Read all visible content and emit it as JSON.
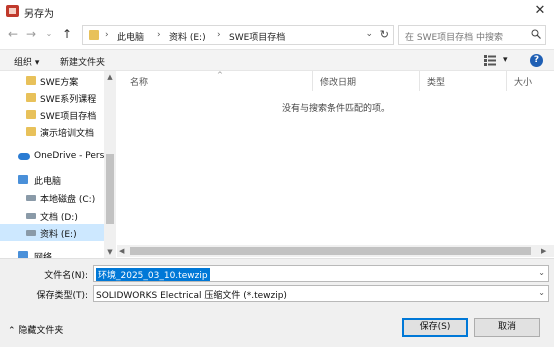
{
  "window": {
    "title": "另存为",
    "close_glyph": "✕"
  },
  "address_bar": {
    "crumbs": [
      "此电脑",
      "资料 (E:)",
      "SWE项目存档"
    ],
    "separator": "›"
  },
  "search": {
    "placeholder": "在 SWE项目存档 中搜索"
  },
  "toolbar": {
    "organize": "组织 ▾",
    "new_folder": "新建文件夹",
    "view_caret": "▾",
    "help": "?"
  },
  "nav_pane": {
    "items": [
      {
        "label": "SWE方案",
        "icon": "folder-icon"
      },
      {
        "label": "SWE系列课程",
        "icon": "folder-icon"
      },
      {
        "label": "SWE项目存档",
        "icon": "folder-icon"
      },
      {
        "label": "演示培训文档",
        "icon": "folder-icon"
      },
      {
        "label": "OneDrive - Perso",
        "icon": "cloud-icon"
      },
      {
        "label": "此电脑",
        "icon": "computer-icon"
      },
      {
        "label": "本地磁盘 (C:)",
        "icon": "drive-icon"
      },
      {
        "label": "文档 (D:)",
        "icon": "drive-icon"
      },
      {
        "label": "资料 (E:)",
        "icon": "drive-icon",
        "selected": true
      },
      {
        "label": "网络",
        "icon": "network-icon"
      }
    ]
  },
  "file_list": {
    "columns": [
      "名称",
      "修改日期",
      "类型",
      "大小"
    ],
    "empty_message": "没有与搜索条件匹配的项。"
  },
  "form": {
    "filename_label": "文件名(N):",
    "filename_value": "环境_2025_03_10.tewzip",
    "filetype_label": "保存类型(T):",
    "filetype_value": "SOLIDWORKS Electrical 压缩文件 (*.tewzip)"
  },
  "footer": {
    "hide_folders": "隐藏文件夹",
    "save": "保存(S)",
    "cancel": "取消"
  },
  "colors": {
    "accent": "#0078d7",
    "selected_bg": "#cde8ff",
    "folder": "#e8c15a"
  }
}
